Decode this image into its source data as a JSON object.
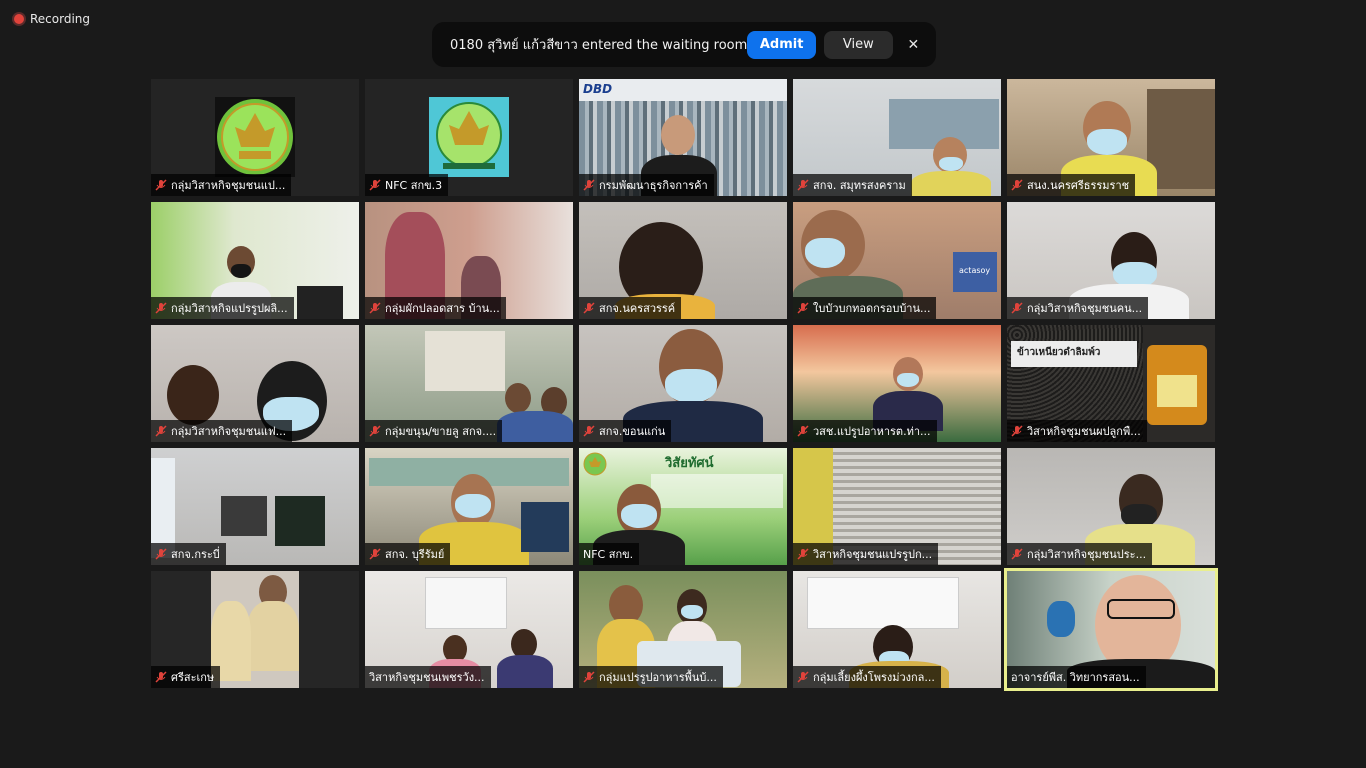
{
  "recording": {
    "label": "Recording"
  },
  "waiting_room": {
    "message": "0180 สุวิทย์ แก้วสีขาว entered the waiting room",
    "admit_label": "Admit",
    "view_label": "View",
    "close_label": "✕"
  },
  "colors": {
    "accent": "#0e72ed",
    "active_speaker_border": "#e9ef8e",
    "muted_icon": "#e0433b"
  },
  "participants": [
    {
      "name": "กลุ่มวิสาหกิจชุมชนแป...",
      "muted": true
    },
    {
      "name": "NFC สกข.3",
      "muted": true
    },
    {
      "name": "กรมพัฒนาธุรกิจการค้า",
      "muted": true
    },
    {
      "name": "สกจ. สมุทรสงคราม",
      "muted": true
    },
    {
      "name": "สนง.นครศรีธรรมราช",
      "muted": true
    },
    {
      "name": "กลุ่มวิสาหกิจแปรรูปผลิ...",
      "muted": true
    },
    {
      "name": "กลุ่มผักปลอดสาร บ้าน...",
      "muted": true
    },
    {
      "name": "สกจ.นครสวรรค์",
      "muted": true
    },
    {
      "name": "ใบบัวบกทอดกรอบบ้าน...",
      "muted": true
    },
    {
      "name": "กลุ่มวิสาหกิจชุมชนคน...",
      "muted": true
    },
    {
      "name": "กลุ่มวิสาหกิจชุมชนแฟ...",
      "muted": true
    },
    {
      "name": "กลุ่มขนุน/ขายลู สกจ....",
      "muted": true
    },
    {
      "name": "สกจ.ขอนแก่น",
      "muted": true
    },
    {
      "name": "วสช.แปรูปอาหารต.ท่า...",
      "muted": true
    },
    {
      "name": "วิสาหกิจชุมชนผปลูกพื...",
      "muted": true
    },
    {
      "name": "สกจ.กระบี่",
      "muted": true
    },
    {
      "name": "สกจ. บุรีรัมย์",
      "muted": true
    },
    {
      "name": "NFC สกข.",
      "muted": false
    },
    {
      "name": "วิสาหกิจชุมชนแปรรูปก...",
      "muted": true
    },
    {
      "name": "กลุ่มวิสาหกิจชุมชนประ...",
      "muted": true
    },
    {
      "name": "ศรีสะเกษ",
      "muted": true
    },
    {
      "name": "วิสาหกิจชุมชนเพชรวัง...",
      "muted": false
    },
    {
      "name": "กลุ่มแปรรูปอาหารพื้นบ้...",
      "muted": true
    },
    {
      "name": "กลุ่มเลี้ยงผึ้งโพรงม่วงกล...",
      "muted": true
    },
    {
      "name": "อาจารย์พีส. วิทยากรสอน...",
      "muted": false
    }
  ],
  "tile_overlays": {
    "dbd_logo": "DBD",
    "slide_title": "วิสัยทัศน์",
    "product_label": "ข้าวเหนียวดำลิมพ์ว",
    "sign_text": "actasoy"
  }
}
